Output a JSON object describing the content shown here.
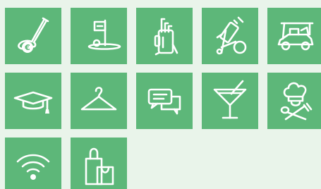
{
  "colors": {
    "page_background": "#e9f4ea",
    "tile_background": "#5db779",
    "icon_stroke": "#ffffff",
    "euro_fill": "#5db779"
  },
  "tiles": [
    {
      "icon": "golf-club-euro-icon"
    },
    {
      "icon": "golf-hole-flag-icon"
    },
    {
      "icon": "golf-bag-icon"
    },
    {
      "icon": "golf-trolley-icon"
    },
    {
      "icon": "golf-cart-icon"
    },
    {
      "icon": "graduation-cap-icon"
    },
    {
      "icon": "clothes-hanger-icon"
    },
    {
      "icon": "chat-bubbles-icon"
    },
    {
      "icon": "cocktail-glass-icon"
    },
    {
      "icon": "chef-restaurant-icon"
    },
    {
      "icon": "wifi-icon"
    },
    {
      "icon": "shopping-bags-icon"
    }
  ]
}
